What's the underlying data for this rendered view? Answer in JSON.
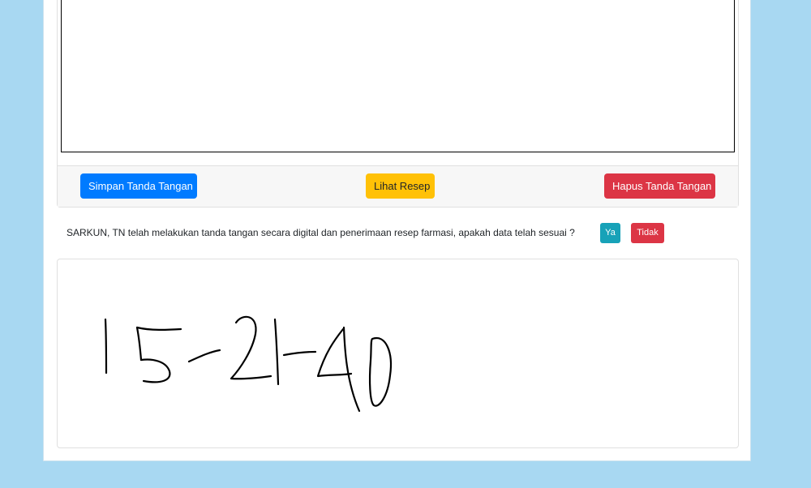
{
  "signature_pad": {
    "save_label": "Simpan Tanda Tangan",
    "view_label": "Lihat Resep",
    "clear_label": "Hapus Tanda Tangan"
  },
  "confirmation": {
    "message": "SARKUN, TN telah melakukan tanda tangan secara digital dan penerimaan resep farmasi, apakah data telah sesuai ?",
    "yes_label": "Ya",
    "no_label": "Tidak"
  },
  "colors": {
    "background": "#a8d8f2",
    "primary": "#007bff",
    "warning": "#ffc107",
    "danger": "#dc3545",
    "info": "#17a2b8"
  },
  "saved_signature": {
    "handwritten_text": "15-21-40"
  }
}
